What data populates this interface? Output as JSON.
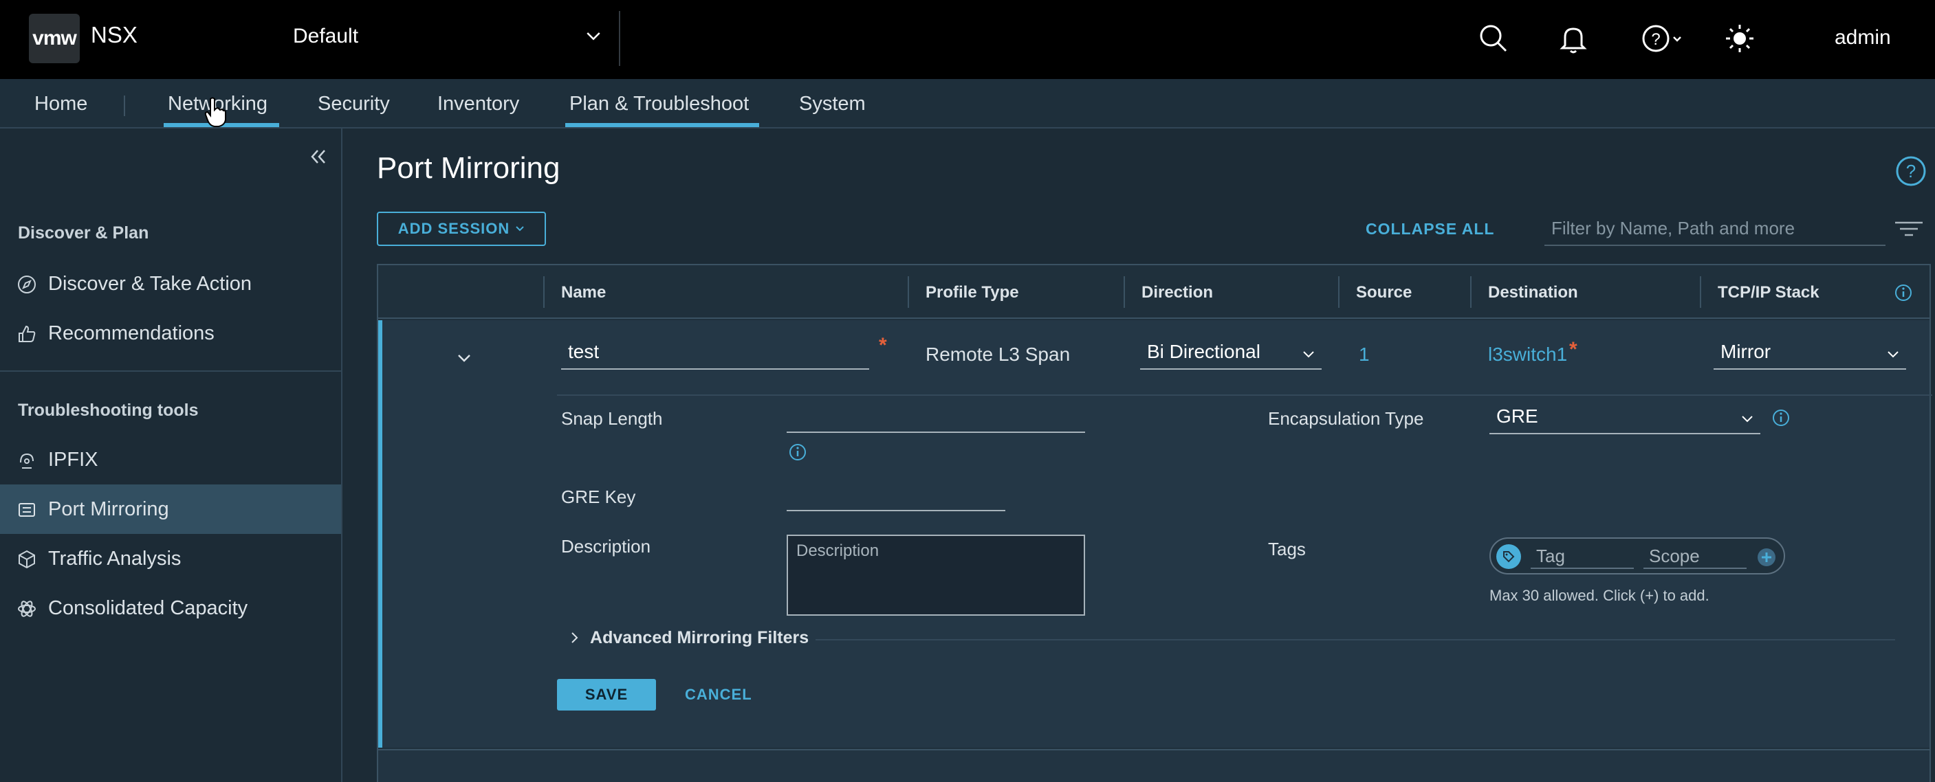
{
  "header": {
    "logo": "vmw",
    "product": "NSX",
    "tenant": "Default",
    "user": "admin"
  },
  "nav": {
    "tabs": [
      {
        "label": "Home"
      },
      {
        "label": "Networking"
      },
      {
        "label": "Security"
      },
      {
        "label": "Inventory"
      },
      {
        "label": "Plan & Troubleshoot"
      },
      {
        "label": "System"
      }
    ],
    "active": "Plan & Troubleshoot",
    "hovered": "Networking"
  },
  "sidebar": {
    "sections": [
      {
        "title": "Discover & Plan",
        "items": [
          {
            "label": "Discover & Take Action",
            "icon": "compass-icon"
          },
          {
            "label": "Recommendations",
            "icon": "thumbs-up-icon"
          }
        ]
      },
      {
        "title": "Troubleshooting tools",
        "items": [
          {
            "label": "IPFIX",
            "icon": "ipfix-icon"
          },
          {
            "label": "Port Mirroring",
            "icon": "port-mirroring-icon",
            "active": true
          },
          {
            "label": "Traffic Analysis",
            "icon": "cube-icon"
          },
          {
            "label": "Consolidated Capacity",
            "icon": "atom-icon"
          }
        ]
      }
    ]
  },
  "main": {
    "title": "Port Mirroring",
    "add_session": "ADD SESSION",
    "collapse_all": "COLLAPSE ALL",
    "filter_placeholder": "Filter by Name, Path and more",
    "columns": [
      "Name",
      "Profile Type",
      "Direction",
      "Source",
      "Destination",
      "TCP/IP Stack"
    ],
    "row": {
      "name": "test",
      "profile_type": "Remote L3 Span",
      "direction": "Bi Directional",
      "source": "1",
      "destination": "l3switch1",
      "tcpip_stack": "Mirror"
    },
    "form": {
      "snap_length_label": "Snap Length",
      "snap_length_value": "",
      "encapsulation_label": "Encapsulation Type",
      "encapsulation_value": "GRE",
      "gre_key_label": "GRE Key",
      "gre_key_value": "",
      "description_label": "Description",
      "description_placeholder": "Description",
      "tags_label": "Tags",
      "tag_placeholder": "Tag",
      "scope_placeholder": "Scope",
      "tags_hint": "Max 30 allowed. Click (+) to add.",
      "advanced_filters": "Advanced Mirroring Filters",
      "save": "SAVE",
      "cancel": "CANCEL"
    }
  },
  "colors": {
    "accent": "#49afd9",
    "required": "#e5603a",
    "header_bg": "#000000",
    "sidebar_active": "#324f61"
  }
}
